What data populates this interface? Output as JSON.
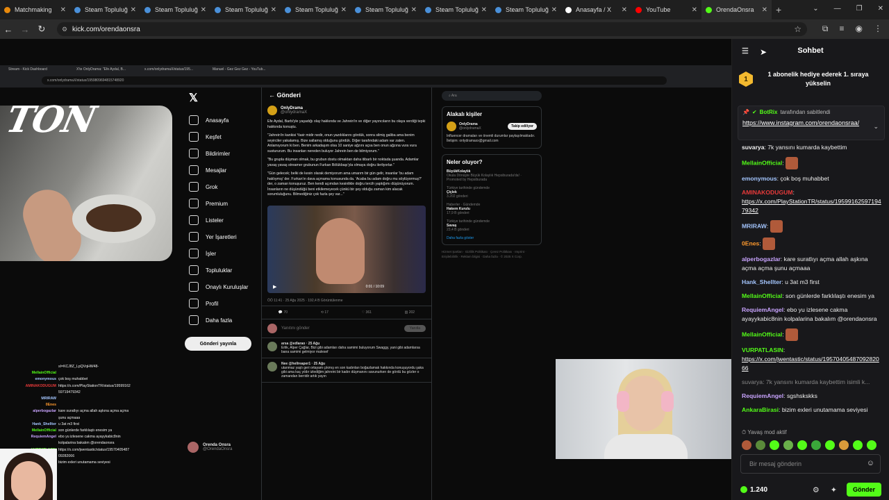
{
  "browser": {
    "tabs": [
      {
        "label": "Matchmaking",
        "color": "#e8890c",
        "active": false
      },
      {
        "label": "Steam Topluluğu",
        "color": "#4a90d9",
        "active": false
      },
      {
        "label": "Steam Topluluğu",
        "color": "#4a90d9",
        "active": false
      },
      {
        "label": "Steam Topluluğu",
        "color": "#4a90d9",
        "active": false
      },
      {
        "label": "Steam Topluluğu",
        "color": "#4a90d9",
        "active": false
      },
      {
        "label": "Steam Topluluğu",
        "color": "#4a90d9",
        "active": false
      },
      {
        "label": "Steam Topluluğu",
        "color": "#4a90d9",
        "active": false
      },
      {
        "label": "Steam Topluluğu",
        "color": "#4a90d9",
        "active": false
      },
      {
        "label": "Anasayfa / X",
        "color": "#ffffff",
        "active": false
      },
      {
        "label": "YouTube",
        "color": "#ff0000",
        "active": false
      },
      {
        "label": "OrendaOnsra",
        "color": "#53fc18",
        "active": true
      }
    ],
    "url": "kick.com/orendaonsra"
  },
  "stream": {
    "logo_text": "TON",
    "inner_tabs": [
      "Stream - Kick Dashboard",
      "X'te OnlyDrama: \"Efe Aydal, B...",
      "x.com/onlydramaX/status/195...",
      "Manuel - Gez Gez Gez - YouTub..."
    ],
    "inner_url": "x.com/onlydramaX/status/1959809694815748920",
    "x_nav": [
      "Anasayfa",
      "Keşfet",
      "Bildirimler",
      "Mesajlar",
      "Grok",
      "Premium",
      "Listeler",
      "Yer İşaretleri",
      "İşler",
      "Topluluklar",
      "Onaylı Kuruluşlar",
      "Profil",
      "Daha fazla"
    ],
    "x_post_button": "Gönderi yayınla",
    "x_profile_name": "Orenda Onsra",
    "x_profile_handle": "@OrendaOnsra",
    "post_header": "Gönderi",
    "author_name": "OnlyDrama",
    "author_handle": "@onlydramaX",
    "post_paragraphs": [
      "Efe Aydal, Barbi'yle yaşadığı olay hakkında ve Jahrein'in ve diğer yayıncıların bu olaya verdiği tepki hakkında konuştu.",
      "\"Jahrein'in kankisi Yasir midir nedir, onun yazdıklarını gördük, sonra silmiş galiba ama benim seyirciler yakalamış. Bize sallamış olduğunu gördük. Diğer tarafındaki adam var zaten. Anlamıyorum ki ben. Benim arkadaşım olsa 10 saniye ağzını açsa ben onun ağzına vura vura sustururum. Bu insanları nereden buluyor Jahrein ben de bilmiyorum.\"",
      "\"Bu grupla düşman olmak, bu grubun dostu olmaktan daha itibarlı bir noktada şuanda. Adamlar yavaş yavaş streamer grubunun Furkan Bölükbaşı'yla olmaya doğru ilerliyorlar.\"",
      "\"Gün gelecek; belki de kesin olarak demiyorum ama umarım bir gün gelir, insanlar 'bu adam haklıymış' der. Furkan'ın dava açmama konusunda da. 'Acaba bu adam doğru mu söylüyormuş?' der, o zaman konuşuruz. Ben kendi açımdan kesinlikle doğru tercih yaptığımı düşünüyorum. İnsanların ne düşündüğü beni etkilemeyecek çünkü bir şey olduğu zaman kim alacak sorumluluğunu. Bilmediğiniz çok fazla şey var...\""
    ],
    "video_time": "0:01 / 10:09",
    "post_meta": "ÖÖ 11:41 · 25 Ağu 2025 · 192,4 B Görüntülenme",
    "post_actions": [
      "70",
      "17",
      "361",
      "202"
    ],
    "reply_placeholder": "Yanıtını gönder",
    "reply_button": "Yanıtla",
    "replies": [
      {
        "user": "arsa @edlarao · 25 Ağu",
        "text": "Erlik, Alper Çağlar, Bizi gibi adamları daha samimi buluyorum Swaggy, yani gibi adamlarsa bana samimi gelmiyor malesef"
      },
      {
        "user": "Nee @hellreaper1 · 25 Ağu",
        "text": "utanmaz yaşlı geri ortayam çıkmış en son kadınları boğazlamak hakkında konuşuyordu şaka gibi ama kaç yıldır izlediğim jahreini bir kadın düşmanını savunurken de gördü bu gözler o zamandan berridir artık yayın"
      }
    ],
    "x_search": "Ara",
    "related_title": "Alakalı kişiler",
    "related_name": "OnlyDrama",
    "related_handle": "@onlydramaX",
    "related_follow": "Takip ediliyor",
    "related_bio": "Influencer dramaları ve önemli durumlar paylaşılmaktadır. İletişim: onlydramaxx@gmail.com",
    "trends_title": "Neler oluyor?",
    "trends": [
      {
        "sub": "",
        "title": "BüyükKolaylık",
        "note": "Okula Dönüşte Büyük Kolaylık Hepsiburada'da! · Promoted by Hepsiburada"
      },
      {
        "sub": "Türkiye tarihinde gündemde",
        "title": "Çiçlek",
        "note": "3.202 gönderi"
      },
      {
        "sub": "Haberler · Gündemde",
        "title": "Hakem Kurulu",
        "note": "17,9 B gönderi"
      },
      {
        "sub": "Türkiye tarihinde gündemde",
        "title": "Savaş",
        "note": "23,4 B gönderi"
      }
    ],
    "trends_more": "Daha fazla göster",
    "footer_links": "Hizmet Şartları · Gizlilik Politikası · Çerez Politikası · Imprint · Erişilebilirlik · Reklam bilgisi · Daha fazla · © 2025 X Corp."
  },
  "overlay_chat": [
    {
      "user": "",
      "text": "sI=KCJ8Z_LpQVqHW48-",
      "color": "#ffffff"
    },
    {
      "user": "MellainOfficial",
      "text": "",
      "color": "#53fc18"
    },
    {
      "user": "emonymous",
      "text": "çok boş muhabbet",
      "color": "#a4c6ff"
    },
    {
      "user": "AMINAKODUGUM",
      "text": "https://x.com/PlayStationTR/status/19599162",
      "color": "#e83a3a"
    },
    {
      "user": "",
      "text": "59719479342",
      "color": "#ffffff"
    },
    {
      "user": "MRIRAW",
      "text": "",
      "color": "#a4c6ff"
    },
    {
      "user": "0Enes",
      "text": "",
      "color": "#ff9a2e"
    },
    {
      "user": "alperbogazlar",
      "text": "kare suratlıyı açma allah aşkına açma açma",
      "color": "#c9a4ff"
    },
    {
      "user": "",
      "text": "şunu açmaaa",
      "color": "#ffffff"
    },
    {
      "user": "Hank_Shellter",
      "text": "u 3at m3 first",
      "color": "#a4c6ff"
    },
    {
      "user": "MellainOfficial",
      "text": "son günlerde farklılaştı enesim ya",
      "color": "#53fc18"
    },
    {
      "user": "RequiemAngel",
      "text": "ebo yu izlesene cakma ayayykabic8nin",
      "color": "#c9a4ff"
    },
    {
      "user": "",
      "text": "kolpalarina bakalım @orendaonsra",
      "color": "#ffffff"
    },
    {
      "user": "",
      "text": "",
      "color": "#ffffff"
    },
    {
      "user": "VURPATLASIN",
      "text": "https://x.com/jwentastic/status/19570405487",
      "color": "#53fc18"
    },
    {
      "user": "",
      "text": "09282066",
      "color": "#ffffff"
    },
    {
      "user": "AnkaraBirasi",
      "text": "bizim exleri unutamama seviyesi",
      "color": "#53fc18"
    }
  ],
  "chat": {
    "title": "Sohbet",
    "gift_badge": "1",
    "gift_text": "1 abonelik hediye ederek 1. sıraya yükselin",
    "pinned_by": "BotRix",
    "pinned_suffix": "tarafından sabitlendi",
    "pinned_link": "https://www.instagram.com/orendaonsraa/",
    "messages": [
      {
        "user": "suvarya",
        "text": "7k yansını kumarda kaybettim",
        "color": "#f0f0f0",
        "link": false,
        "emote": false
      },
      {
        "user": "MellainOfficial",
        "text": "",
        "color": "#53fc18",
        "link": false,
        "emote": true
      },
      {
        "user": "emonymous",
        "text": "çok boş muhabbet",
        "color": "#a4c6ff",
        "link": false,
        "emote": false
      },
      {
        "user": "AMINAKODUGUM",
        "text": "https://x.com/PlayStationTR/status/1959916259719479342",
        "color": "#e83a3a",
        "link": true,
        "emote": false
      },
      {
        "user": "MRIRAW",
        "text": "",
        "color": "#a4c6ff",
        "link": false,
        "emote": true
      },
      {
        "user": "0Enes",
        "text": "",
        "color": "#ff9a2e",
        "link": false,
        "emote": true
      },
      {
        "user": "alperbogazlar",
        "text": "kare suratlıyı açma allah aşkına açma açma şunu açmaaa",
        "color": "#c9a4ff",
        "link": false,
        "emote": false
      },
      {
        "user": "Hank_Shellter",
        "text": "u 3at m3 first",
        "color": "#a4c6ff",
        "link": false,
        "emote": false
      },
      {
        "user": "MellainOfficial",
        "text": "son günlerde farklılaştı enesim ya",
        "color": "#53fc18",
        "link": false,
        "emote": false
      },
      {
        "user": "RequiemAngel",
        "text": "ebo yu izlesene cakma ayayykabic8nin kolpalarina bakalım @orendaonsra",
        "color": "#c9a4ff",
        "link": false,
        "emote": false
      },
      {
        "user": "MellainOfficial",
        "text": "",
        "color": "#53fc18",
        "link": false,
        "emote": true
      },
      {
        "user": "VURPATLASIN",
        "text": "https://x.com/jwentastic/status/1957040548709282066",
        "color": "#53fc18",
        "link": true,
        "emote": false
      },
      {
        "user": "",
        "text": "suvarya: 7k yansını kumarda kaybettim isimli k...",
        "color": "#888888",
        "link": false,
        "emote": false,
        "system": true
      },
      {
        "user": "RequiemAngel",
        "text": "sgshskskks",
        "color": "#c9a4ff",
        "link": false,
        "emote": false
      },
      {
        "user": "AnkaraBirasi",
        "text": "bizim exleri unutamama seviyesi",
        "color": "#53fc18",
        "link": false,
        "emote": false
      }
    ],
    "slow_mode": "Yavaş mod aktif",
    "input_placeholder": "Bir mesaj gönderin",
    "points": "1.240",
    "send_label": "Gönder"
  }
}
